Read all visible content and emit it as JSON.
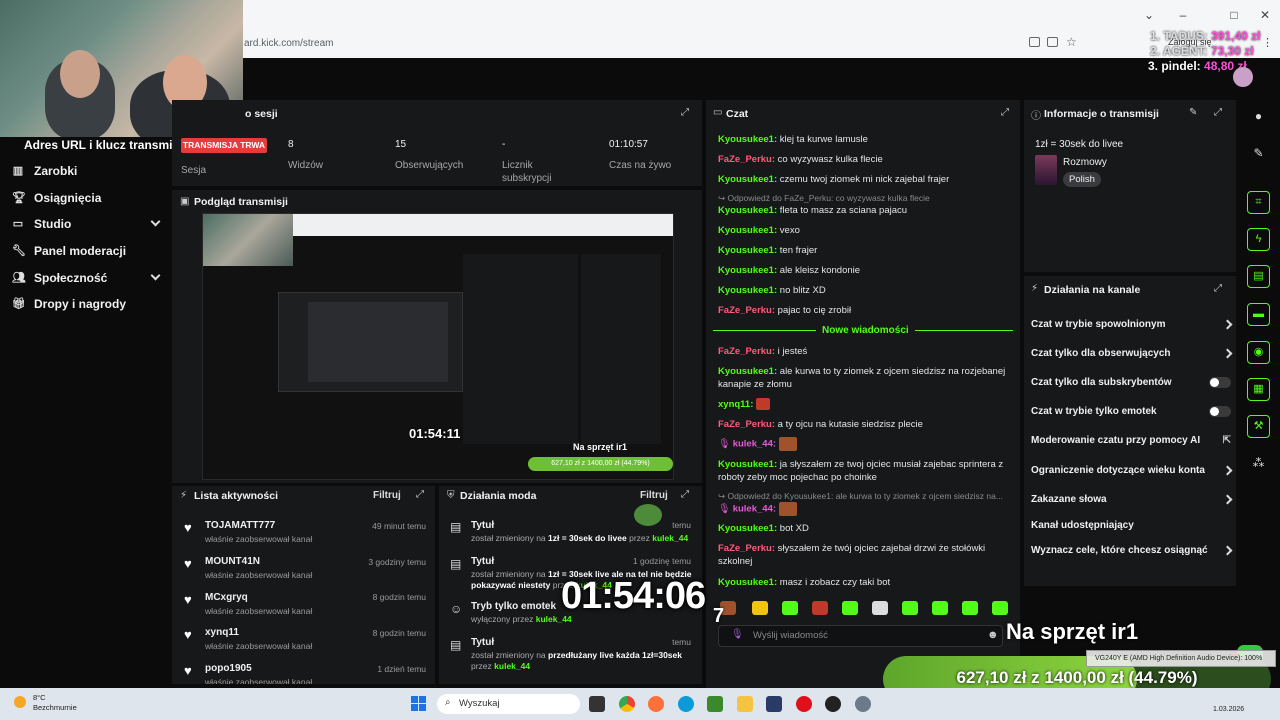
{
  "browser": {
    "url": "ard.kick.com/stream",
    "profile_label": "Zaloguj się"
  },
  "goals": [
    {
      "name": "1. TADUS:",
      "amount": "391,40 zł"
    },
    {
      "name": "2. AGENT:",
      "amount": "73,30 zł"
    },
    {
      "name": "3. pindel:",
      "amount": "48,80 zł"
    }
  ],
  "sidebar": {
    "title": "Adres URL i klucz transmisji",
    "items": [
      {
        "label": "Zarobki",
        "icon": "bar-chart-icon"
      },
      {
        "label": "Osiągnięcia",
        "icon": "trophy-icon"
      },
      {
        "label": "Studio",
        "icon": "monitor-icon"
      },
      {
        "label": "Panel moderacji",
        "icon": "wrench-icon"
      },
      {
        "label": "Społeczność",
        "icon": "users-icon"
      },
      {
        "label": "Dropy i nagrody",
        "icon": "gift-icon"
      }
    ]
  },
  "session": {
    "title": "o sesji",
    "live_badge": "TRANSMISJA TRWA",
    "session_label": "Sesja",
    "stats": [
      {
        "value": "8",
        "label": "Widzów"
      },
      {
        "value": "15",
        "label": "Obserwujących"
      },
      {
        "value": "-",
        "label": "Licznik subskrypcji"
      },
      {
        "value": "01:10:57",
        "label": "Czas na żywo"
      }
    ]
  },
  "preview": {
    "title": "Podgląd transmisji",
    "inner_timer": "01:54:11",
    "inner_donate": "Na sprzęt ir1",
    "inner_progress": "627,10 zł z 1400,00 zł (44.79%)"
  },
  "activity": {
    "title": "Lista aktywności",
    "filter": "Filtruj",
    "items": [
      {
        "name": "TOJAMATT777",
        "text": "właśnie zaobserwował kanał",
        "time": "49 minut temu"
      },
      {
        "name": "MOUNT41N",
        "text": "właśnie zaobserwował kanał",
        "time": "3 godziny temu"
      },
      {
        "name": "MCxgryq",
        "text": "właśnie zaobserwował kanał",
        "time": "8 godzin temu"
      },
      {
        "name": "xynq11",
        "text": "właśnie zaobserwował kanał",
        "time": "8 godzin temu"
      },
      {
        "name": "popo1905",
        "text": "właśnie zaobserwował kanał",
        "time": "1 dzień temu"
      }
    ]
  },
  "mod_actions": {
    "title": "Działania moda",
    "filter": "Filtruj",
    "items": [
      {
        "title": "Tytuł",
        "line1": "został zmieniony na",
        "value": "1zł = 30sek do livee",
        "by_label": "przez",
        "by": "kulek_44",
        "time": "temu"
      },
      {
        "title": "Tytuł",
        "line1": "został zmieniony na",
        "value": "1zł = 30sek live ale na tel nie będzie pokazywać niestety",
        "by_label": "przez",
        "by": "kulek_44",
        "time": "1 godzinę temu"
      },
      {
        "title": "Tryb tylko emotek",
        "line1": "wyłączony przez",
        "value": "",
        "by_label": "",
        "by": "kulek_44",
        "time": ""
      },
      {
        "title": "Tytuł",
        "line1": "został zmieniony na",
        "value": "przedłużany live każda 1zł=30sek",
        "by_label": "przez",
        "by": "kulek_44",
        "time": "temu"
      }
    ]
  },
  "chat": {
    "title": "Czat",
    "new_messages": "Nowe wiadomości",
    "input_placeholder": "Wyślij wiadomość",
    "messages": [
      {
        "user": "Kyousukee1:",
        "text": "klej ta kurwe lamusle",
        "color": "green"
      },
      {
        "user": "FaZe_Perku:",
        "text": "co wyzywasz kulka flecie",
        "color": "pink"
      },
      {
        "user": "Kyousukee1:",
        "text": "czemu twoj ziomek mi nick zajebal frajer",
        "color": "green"
      },
      {
        "reply": "Odpowiedź do FaZe_Perku: co wyzywasz kulka flecie",
        "user": "Kyousukee1:",
        "text": "fleta to masz za sciana pajacu",
        "color": "green"
      },
      {
        "user": "Kyousukee1:",
        "text": "vexo",
        "color": "green"
      },
      {
        "user": "Kyousukee1:",
        "text": "ten frajer",
        "color": "green"
      },
      {
        "user": "Kyousukee1:",
        "text": "ale kleisz kondonie",
        "color": "green"
      },
      {
        "user": "Kyousukee1:",
        "text": "no blitz XD",
        "color": "green"
      },
      {
        "user": "FaZe_Perku:",
        "text": "pajac to cię zrobił",
        "color": "pink"
      },
      {
        "user": "FaZe_Perku:",
        "text": "i jesteś",
        "color": "pink"
      },
      {
        "user": "Kyousukee1:",
        "text": "ale kurwa to ty ziomek z ojcem siedzisz na rozjebanej kanapie ze złomu",
        "color": "green"
      },
      {
        "user": "xynq11:",
        "text": "",
        "color": "green"
      },
      {
        "user": "FaZe_Perku:",
        "text": "a ty ojcu na kutasie siedzisz plecie",
        "color": "pink"
      },
      {
        "user": "kulek_44:",
        "text": "",
        "color": "pink2"
      },
      {
        "user": "Kyousukee1:",
        "text": "ja słyszałem ze twoj ojciec musiał zajebac sprintera z roboty zeby moc pojechac po choinke",
        "color": "green"
      },
      {
        "reply": "Odpowiedź do Kyousukee1: ale kurwa to ty ziomek z ojcem siedzisz na...",
        "user": "kulek_44:",
        "text": "",
        "color": "pink2"
      },
      {
        "user": "Kyousukee1:",
        "text": "bot XD",
        "color": "green"
      },
      {
        "user": "FaZe_Perku:",
        "text": "słyszałem że twój ojciec zajebał drzwi że stołówki szkolnej",
        "color": "pink"
      },
      {
        "user": "Kyousukee1:",
        "text": "masz i zobacz czy taki bot",
        "color": "green"
      }
    ]
  },
  "stream_info": {
    "title": "Informacje o transmisji",
    "stream_title": "1zł = 30sek do livee",
    "category": "Rozmowy",
    "language": "Polish"
  },
  "channel_actions": {
    "title": "Działania na kanale",
    "items": [
      {
        "label": "Czat w trybie spowolnionym",
        "control": "arrow"
      },
      {
        "label": "Czat tylko dla obserwujących",
        "control": "arrow"
      },
      {
        "label": "Czat tylko dla subskrybentów",
        "control": "toggle"
      },
      {
        "label": "Czat w trybie tylko emotek",
        "control": "toggle"
      },
      {
        "label": "Moderowanie czatu przy pomocy AI",
        "control": "external"
      },
      {
        "label": "Ograniczenie dotyczące wieku konta",
        "control": "arrow"
      },
      {
        "label": "Zakazane słowa",
        "control": "arrow"
      },
      {
        "label": "Kanał udostępniający",
        "control": "none"
      },
      {
        "label": "Wyznacz cele, które chcesz osiągnąć",
        "control": "arrow"
      }
    ]
  },
  "overlay": {
    "timer": "01:54:06",
    "timer_extra": "7",
    "donate_title": "Na sprzęt ir1",
    "progress_text": "627,10 zł z 1400,00 zł (44.79%)",
    "progress_fraction": 0.4479,
    "audio_device": "VG240Y E (AMD High Definition Audio Device): 100%"
  },
  "taskbar": {
    "search": "Wyszukaj",
    "weather_temp": "8°C",
    "weather_desc": "Bezchmurnie",
    "date": "1.03.2026"
  },
  "colors": {
    "accent": "#53fc18",
    "live_red": "#e53b3b",
    "goal_pink": "#ff4fd8"
  }
}
